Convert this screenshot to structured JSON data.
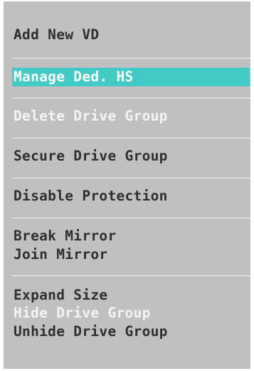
{
  "menu": {
    "items": {
      "add_new_vd": "Add New VD",
      "manage_ded_hs": "Manage Ded. HS",
      "delete_drive_group": "Delete Drive Group",
      "secure_drive_group": "Secure Drive Group",
      "disable_protection": "Disable Protection",
      "break_mirror": "Break Mirror",
      "join_mirror": "Join Mirror",
      "expand_size": "Expand Size",
      "hide_drive_group": "Hide Drive Group",
      "unhide_drive_group": "Unhide Drive Group"
    },
    "selected": "manage_ded_hs",
    "disabled": [
      "delete_drive_group",
      "hide_drive_group"
    ],
    "colors": {
      "background": "#c0c0c0",
      "text": "#2f2f2f",
      "disabled_text": "#f4f4f4",
      "highlight": "#41cbc4",
      "highlight_text": "#ffffff",
      "separator": "#f2f2f2"
    }
  }
}
